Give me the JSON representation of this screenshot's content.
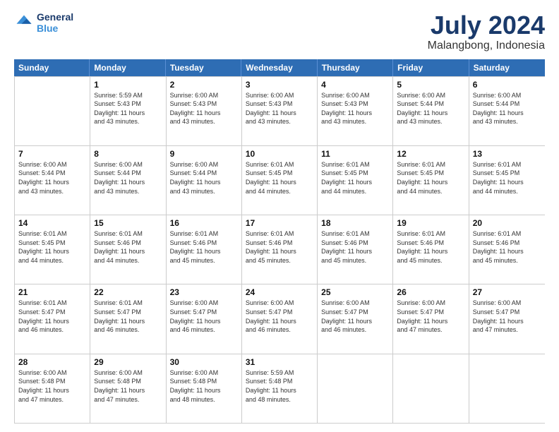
{
  "logo": {
    "line1": "General",
    "line2": "Blue"
  },
  "title": "July 2024",
  "subtitle": "Malangbong, Indonesia",
  "header_days": [
    "Sunday",
    "Monday",
    "Tuesday",
    "Wednesday",
    "Thursday",
    "Friday",
    "Saturday"
  ],
  "weeks": [
    [
      {
        "day": "",
        "info": ""
      },
      {
        "day": "1",
        "info": "Sunrise: 5:59 AM\nSunset: 5:43 PM\nDaylight: 11 hours\nand 43 minutes."
      },
      {
        "day": "2",
        "info": "Sunrise: 6:00 AM\nSunset: 5:43 PM\nDaylight: 11 hours\nand 43 minutes."
      },
      {
        "day": "3",
        "info": "Sunrise: 6:00 AM\nSunset: 5:43 PM\nDaylight: 11 hours\nand 43 minutes."
      },
      {
        "day": "4",
        "info": "Sunrise: 6:00 AM\nSunset: 5:43 PM\nDaylight: 11 hours\nand 43 minutes."
      },
      {
        "day": "5",
        "info": "Sunrise: 6:00 AM\nSunset: 5:44 PM\nDaylight: 11 hours\nand 43 minutes."
      },
      {
        "day": "6",
        "info": "Sunrise: 6:00 AM\nSunset: 5:44 PM\nDaylight: 11 hours\nand 43 minutes."
      }
    ],
    [
      {
        "day": "7",
        "info": "Sunrise: 6:00 AM\nSunset: 5:44 PM\nDaylight: 11 hours\nand 43 minutes."
      },
      {
        "day": "8",
        "info": "Sunrise: 6:00 AM\nSunset: 5:44 PM\nDaylight: 11 hours\nand 43 minutes."
      },
      {
        "day": "9",
        "info": "Sunrise: 6:00 AM\nSunset: 5:44 PM\nDaylight: 11 hours\nand 43 minutes."
      },
      {
        "day": "10",
        "info": "Sunrise: 6:01 AM\nSunset: 5:45 PM\nDaylight: 11 hours\nand 44 minutes."
      },
      {
        "day": "11",
        "info": "Sunrise: 6:01 AM\nSunset: 5:45 PM\nDaylight: 11 hours\nand 44 minutes."
      },
      {
        "day": "12",
        "info": "Sunrise: 6:01 AM\nSunset: 5:45 PM\nDaylight: 11 hours\nand 44 minutes."
      },
      {
        "day": "13",
        "info": "Sunrise: 6:01 AM\nSunset: 5:45 PM\nDaylight: 11 hours\nand 44 minutes."
      }
    ],
    [
      {
        "day": "14",
        "info": "Sunrise: 6:01 AM\nSunset: 5:45 PM\nDaylight: 11 hours\nand 44 minutes."
      },
      {
        "day": "15",
        "info": "Sunrise: 6:01 AM\nSunset: 5:46 PM\nDaylight: 11 hours\nand 44 minutes."
      },
      {
        "day": "16",
        "info": "Sunrise: 6:01 AM\nSunset: 5:46 PM\nDaylight: 11 hours\nand 45 minutes."
      },
      {
        "day": "17",
        "info": "Sunrise: 6:01 AM\nSunset: 5:46 PM\nDaylight: 11 hours\nand 45 minutes."
      },
      {
        "day": "18",
        "info": "Sunrise: 6:01 AM\nSunset: 5:46 PM\nDaylight: 11 hours\nand 45 minutes."
      },
      {
        "day": "19",
        "info": "Sunrise: 6:01 AM\nSunset: 5:46 PM\nDaylight: 11 hours\nand 45 minutes."
      },
      {
        "day": "20",
        "info": "Sunrise: 6:01 AM\nSunset: 5:46 PM\nDaylight: 11 hours\nand 45 minutes."
      }
    ],
    [
      {
        "day": "21",
        "info": "Sunrise: 6:01 AM\nSunset: 5:47 PM\nDaylight: 11 hours\nand 46 minutes."
      },
      {
        "day": "22",
        "info": "Sunrise: 6:01 AM\nSunset: 5:47 PM\nDaylight: 11 hours\nand 46 minutes."
      },
      {
        "day": "23",
        "info": "Sunrise: 6:00 AM\nSunset: 5:47 PM\nDaylight: 11 hours\nand 46 minutes."
      },
      {
        "day": "24",
        "info": "Sunrise: 6:00 AM\nSunset: 5:47 PM\nDaylight: 11 hours\nand 46 minutes."
      },
      {
        "day": "25",
        "info": "Sunrise: 6:00 AM\nSunset: 5:47 PM\nDaylight: 11 hours\nand 46 minutes."
      },
      {
        "day": "26",
        "info": "Sunrise: 6:00 AM\nSunset: 5:47 PM\nDaylight: 11 hours\nand 47 minutes."
      },
      {
        "day": "27",
        "info": "Sunrise: 6:00 AM\nSunset: 5:47 PM\nDaylight: 11 hours\nand 47 minutes."
      }
    ],
    [
      {
        "day": "28",
        "info": "Sunrise: 6:00 AM\nSunset: 5:48 PM\nDaylight: 11 hours\nand 47 minutes."
      },
      {
        "day": "29",
        "info": "Sunrise: 6:00 AM\nSunset: 5:48 PM\nDaylight: 11 hours\nand 47 minutes."
      },
      {
        "day": "30",
        "info": "Sunrise: 6:00 AM\nSunset: 5:48 PM\nDaylight: 11 hours\nand 48 minutes."
      },
      {
        "day": "31",
        "info": "Sunrise: 5:59 AM\nSunset: 5:48 PM\nDaylight: 11 hours\nand 48 minutes."
      },
      {
        "day": "",
        "info": ""
      },
      {
        "day": "",
        "info": ""
      },
      {
        "day": "",
        "info": ""
      }
    ]
  ]
}
